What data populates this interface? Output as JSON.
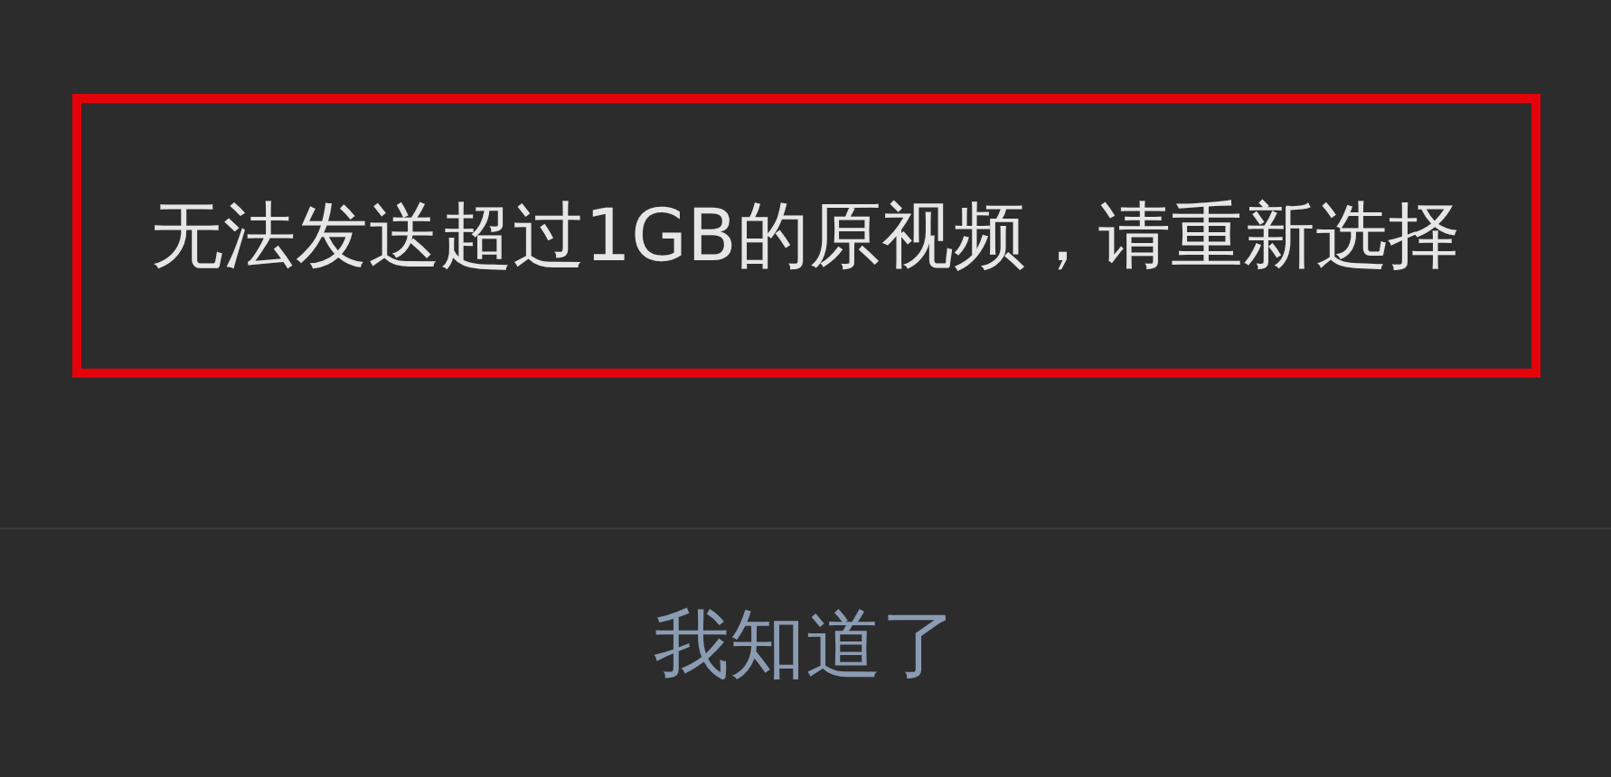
{
  "dialog": {
    "message": "无法发送超过1GB的原视频，请重新选择",
    "highlighted": true,
    "button": "我知道了"
  }
}
